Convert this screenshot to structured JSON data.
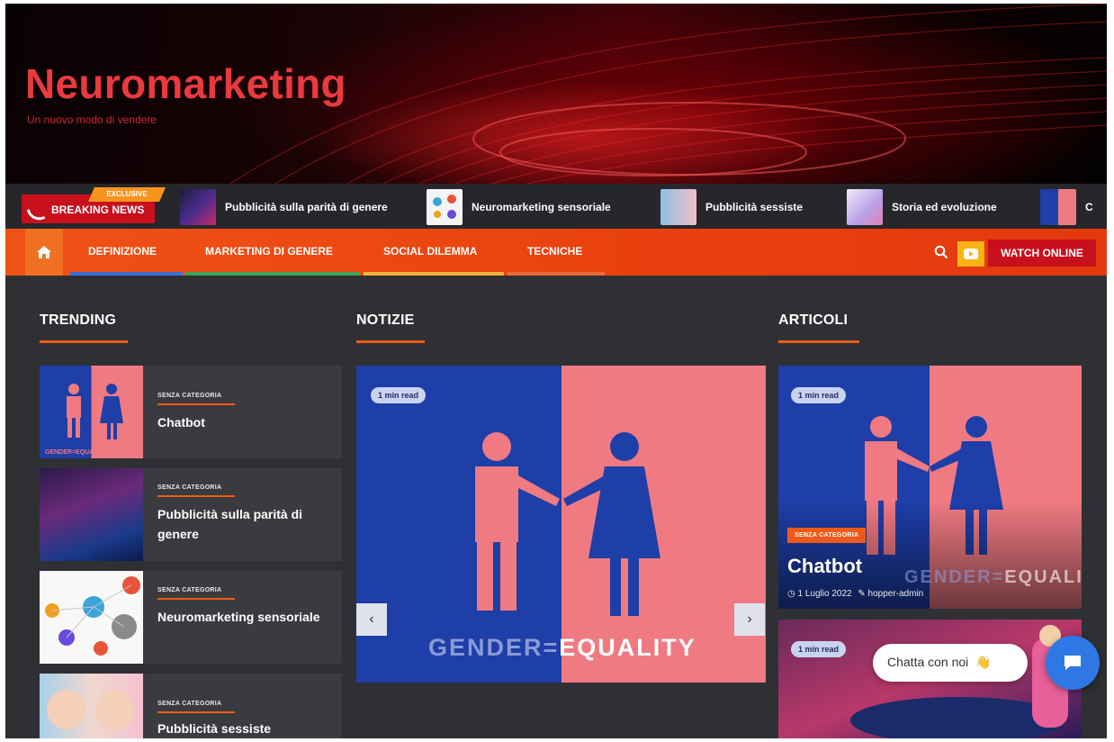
{
  "header": {
    "site_title": "Neuromarketing",
    "tagline": "Un nuovo modo di vendere"
  },
  "breaking": {
    "label": "BREAKING NEWS",
    "exclusive": "EXCLUSIVE",
    "items": [
      {
        "title": "Pubblicità sulla parità di genere"
      },
      {
        "title": "Neuromarketing sensoriale"
      },
      {
        "title": "Pubblicità sessiste"
      },
      {
        "title": "Storia ed evoluzione"
      },
      {
        "title": "C"
      }
    ]
  },
  "nav": {
    "items": [
      {
        "label": "DEFINIZIONE",
        "underline": "#3b6fd8"
      },
      {
        "label": "MARKETING DI GENERE",
        "underline": "#3aa55a"
      },
      {
        "label": "SOCIAL DILEMMA",
        "underline": "#f0b43c"
      },
      {
        "label": "TECNICHE",
        "underline": "#e86a3a"
      }
    ],
    "watch_label": "WATCH ONLINE",
    "accent": "#f05216"
  },
  "sections": {
    "trending": "TRENDING",
    "notizie": "NOTIZIE",
    "articoli": "ARTICOLI"
  },
  "trending": [
    {
      "category": "SENZA CATEGORIA",
      "title": "Chatbot"
    },
    {
      "category": "SENZA CATEGORIA",
      "title": "Pubblicità sulla parità di genere"
    },
    {
      "category": "SENZA CATEGORIA",
      "title": "Neuromarketing sensoriale"
    },
    {
      "category": "SENZA CATEGORIA",
      "title": "Pubblicità sessiste"
    }
  ],
  "slider": {
    "read_time": "1 min read",
    "image_text_left": "GENDER=",
    "image_text_right": "EQUALITY",
    "prev": "‹",
    "next": "›"
  },
  "articoli": {
    "first": {
      "read_time": "1 min read",
      "category": "SENZA CATEGORIA",
      "title": "Chatbot",
      "date": "1 Luglio 2022",
      "author": "hopper-admin",
      "image_text_left": "GENDER=",
      "image_text_right": "EQUALITY"
    },
    "second": {
      "read_time": "1 min read"
    }
  },
  "chat": {
    "label": "Chatta con noi",
    "emoji": "👋"
  }
}
